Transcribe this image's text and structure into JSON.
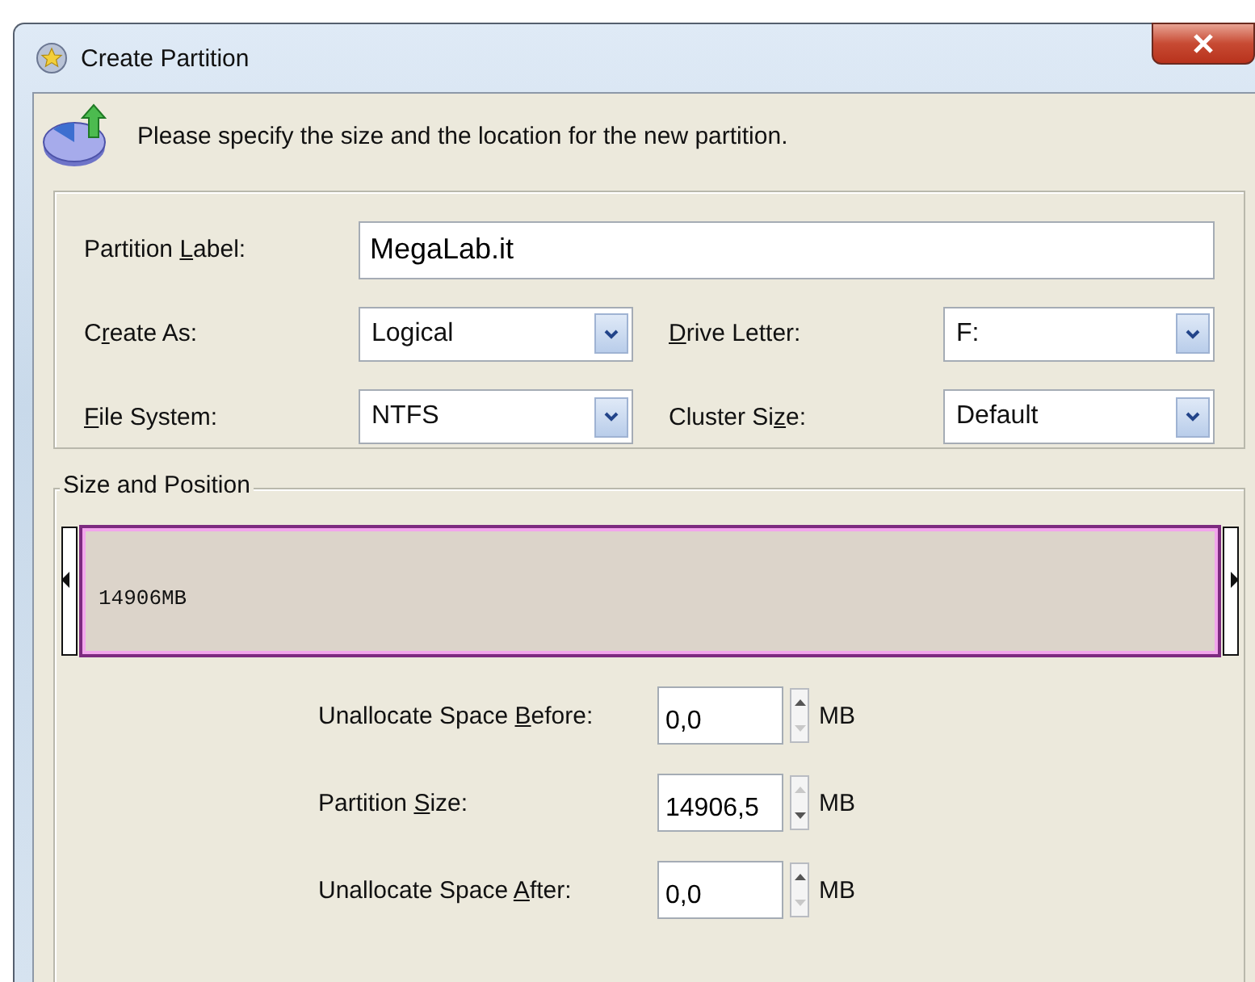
{
  "window": {
    "title": "Create Partition"
  },
  "instruction": "Please specify the size and the location for the new partition.",
  "settings": {
    "label_field": {
      "label": {
        "before": "Partition ",
        "key": "L",
        "after": "abel:"
      },
      "value": "MegaLab.it"
    },
    "combos": [
      {
        "label": {
          "before": "C",
          "key": "r",
          "after": "eate As:"
        },
        "value": "Logical"
      },
      {
        "label": {
          "key": "D",
          "after": "rive Letter:"
        },
        "value": "F:"
      },
      {
        "label": {
          "key": "F",
          "after": "ile System:"
        },
        "value": "NTFS"
      },
      {
        "label": {
          "before": "Cluster Si",
          "key": "z",
          "after": "e:"
        },
        "value": "Default"
      }
    ]
  },
  "size_and_position": {
    "title": "Size and Position",
    "bar": {
      "text": "14906MB"
    },
    "spinners": [
      {
        "label": {
          "before": "Unallocate Space ",
          "key": "B",
          "after": "efore:"
        },
        "value": "0,0",
        "unit": "MB",
        "up_enabled": true,
        "down_enabled": false
      },
      {
        "label": {
          "before": "Partition ",
          "key": "S",
          "after": "ize:"
        },
        "value": "14906,5",
        "unit": "MB",
        "up_enabled": false,
        "down_enabled": true
      },
      {
        "label": {
          "before": "Unallocate Space ",
          "key": "A",
          "after": "fter:"
        },
        "value": "0,0",
        "unit": "MB",
        "up_enabled": true,
        "down_enabled": false
      }
    ]
  }
}
